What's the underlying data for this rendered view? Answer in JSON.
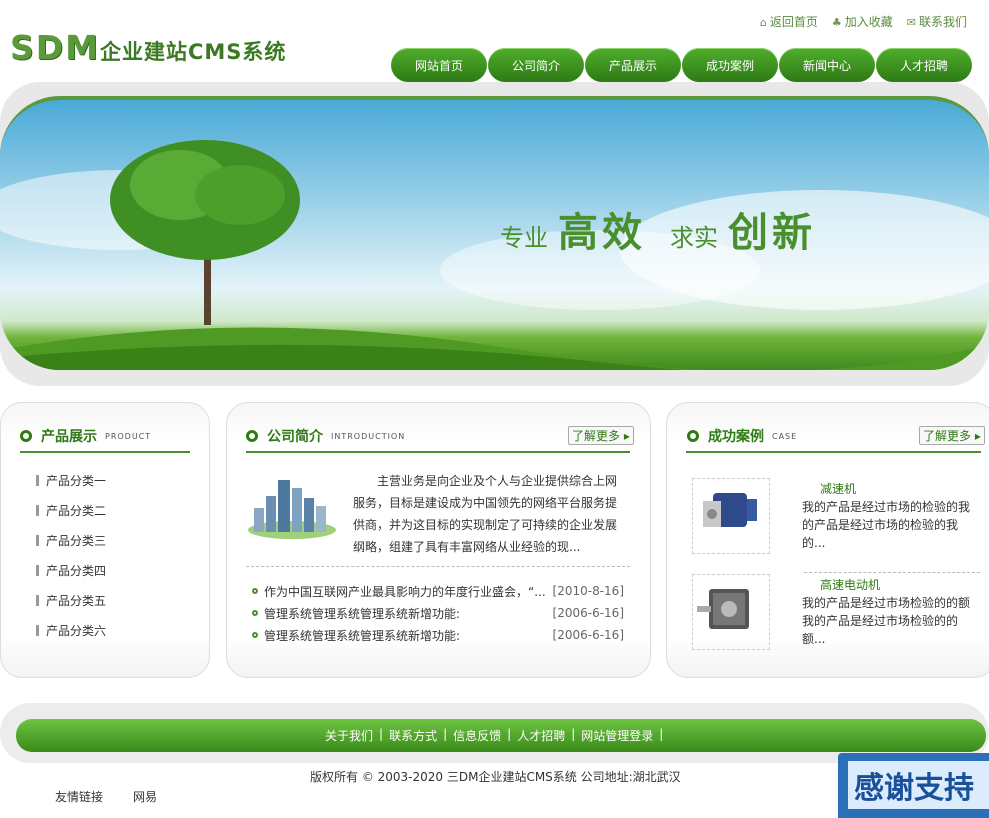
{
  "logo": {
    "text": "SDM",
    "sub": "企业建站CMS系统"
  },
  "top_links": [
    {
      "icon": "home-icon",
      "label": "返回首页"
    },
    {
      "icon": "favorite-icon",
      "label": "加入收藏"
    },
    {
      "icon": "mail-icon",
      "label": "联系我们"
    }
  ],
  "nav": [
    "网站首页",
    "公司简介",
    "产品展示",
    "成功案例",
    "新闻中心",
    "人才招聘"
  ],
  "banner": {
    "slogan": [
      "专业",
      "高效",
      "求实",
      "创新"
    ]
  },
  "products": {
    "title": "产品展示",
    "title_en": "PRODUCT",
    "items": [
      "产品分类一",
      "产品分类二",
      "产品分类三",
      "产品分类四",
      "产品分类五",
      "产品分类六"
    ]
  },
  "about": {
    "title": "公司简介",
    "title_en": "INTRODUCTION",
    "more": "了解更多",
    "text": "主营业务是向企业及个人与企业提供综合上网服务，目标是建设成为中国领先的网络平台服务提供商，并为这目标的实现制定了可持续的企业发展纲略，组建了具有丰富网络从业经验的现...",
    "news": [
      {
        "title": "作为中国互联网产业最具影响力的年度行业盛会，“...",
        "date": "[2010-8-16]"
      },
      {
        "title": "管理系统管理系统管理系统新增功能:",
        "date": "[2006-6-16]"
      },
      {
        "title": "管理系统管理系统管理系统新增功能:",
        "date": "[2006-6-16]"
      }
    ]
  },
  "cases": {
    "title": "成功案例",
    "title_en": "CASE",
    "more": "了解更多",
    "items": [
      {
        "name": "减速机",
        "desc": "我的产品是经过市场的检验的我的产品是经过市场的检验的我的..."
      },
      {
        "name": "高速电动机",
        "desc": "我的产品是经过市场检验的的额我的产品是经过市场检验的的额..."
      }
    ]
  },
  "footer": {
    "links": [
      "关于我们",
      "联系方式",
      "信息反馈",
      "人才招聘",
      "网站管理登录"
    ],
    "copyright": "版权所有 © 2003-2020 三DM企业建站CMS系统 公司地址:湖北武汉",
    "friend_label": "友情链接",
    "friend_links": [
      "网易"
    ],
    "badge": "感谢支持"
  },
  "colors": {
    "brand": "#2e7a14",
    "accent": "#4fae2e"
  }
}
